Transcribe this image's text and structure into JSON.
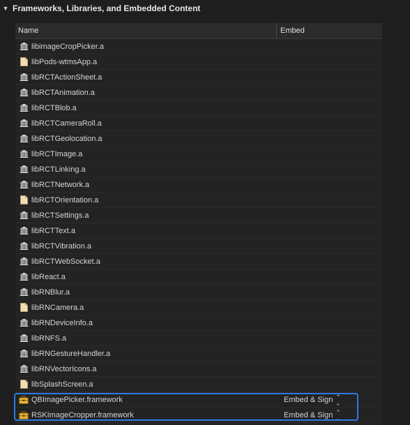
{
  "section": {
    "title": "Frameworks, Libraries, and Embedded Content",
    "disclosure_icon": "disclosure-triangle-open-icon"
  },
  "table": {
    "columns": {
      "name": "Name",
      "embed": "Embed"
    },
    "rows": [
      {
        "name": "libimageCropPicker.a",
        "icon": "library-icon",
        "embed": ""
      },
      {
        "name": "libPods-wtmsApp.a",
        "icon": "document-icon",
        "embed": ""
      },
      {
        "name": "libRCTActionSheet.a",
        "icon": "library-icon",
        "embed": ""
      },
      {
        "name": "libRCTAnimation.a",
        "icon": "library-icon",
        "embed": ""
      },
      {
        "name": "libRCTBlob.a",
        "icon": "library-icon",
        "embed": ""
      },
      {
        "name": "libRCTCameraRoll.a",
        "icon": "library-icon",
        "embed": ""
      },
      {
        "name": "libRCTGeolocation.a",
        "icon": "library-icon",
        "embed": ""
      },
      {
        "name": "libRCTImage.a",
        "icon": "library-icon",
        "embed": ""
      },
      {
        "name": "libRCTLinking.a",
        "icon": "library-icon",
        "embed": ""
      },
      {
        "name": "libRCTNetwork.a",
        "icon": "library-icon",
        "embed": ""
      },
      {
        "name": "libRCTOrientation.a",
        "icon": "document-icon",
        "embed": ""
      },
      {
        "name": "libRCTSettings.a",
        "icon": "library-icon",
        "embed": ""
      },
      {
        "name": "libRCTText.a",
        "icon": "library-icon",
        "embed": ""
      },
      {
        "name": "libRCTVibration.a",
        "icon": "library-icon",
        "embed": ""
      },
      {
        "name": "libRCTWebSocket.a",
        "icon": "library-icon",
        "embed": ""
      },
      {
        "name": "libReact.a",
        "icon": "library-icon",
        "embed": ""
      },
      {
        "name": "libRNBlur.a",
        "icon": "library-icon",
        "embed": ""
      },
      {
        "name": "libRNCamera.a",
        "icon": "document-icon",
        "embed": ""
      },
      {
        "name": "libRNDeviceInfo.a",
        "icon": "library-icon",
        "embed": ""
      },
      {
        "name": "libRNFS.a",
        "icon": "library-icon",
        "embed": ""
      },
      {
        "name": "libRNGestureHandler.a",
        "icon": "library-icon",
        "embed": ""
      },
      {
        "name": "libRNVectorIcons.a",
        "icon": "library-icon",
        "embed": ""
      },
      {
        "name": "libSplashScreen.a",
        "icon": "document-icon",
        "embed": ""
      },
      {
        "name": "QBImagePicker.framework",
        "icon": "framework-toolbox-icon",
        "embed": "Embed & Sign"
      },
      {
        "name": "RSKImageCropper.framework",
        "icon": "framework-toolbox-icon",
        "embed": "Embed & Sign"
      }
    ]
  },
  "colors": {
    "background": "#1e1e1e",
    "highlight_border": "#2e7ae6",
    "toolbox_icon": "#e7b53a"
  }
}
